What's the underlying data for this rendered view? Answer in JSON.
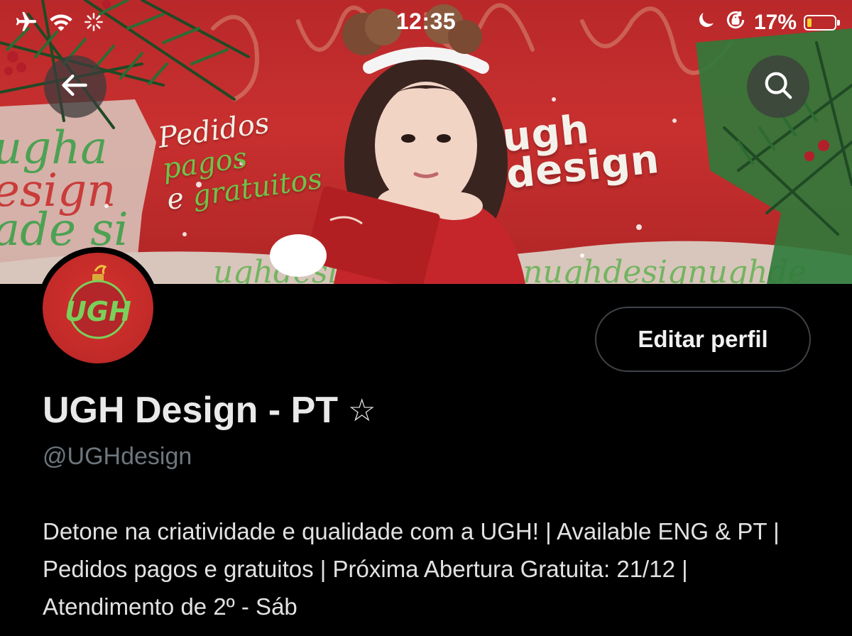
{
  "status_bar": {
    "time": "12:35",
    "battery_percent": "17%",
    "battery_level": 0.17,
    "left_icons": [
      "airplane-icon",
      "wifi-icon",
      "loading-spinner-icon"
    ],
    "right_icons": [
      "moon-icon",
      "orientation-lock-icon",
      "battery-icon"
    ]
  },
  "banner": {
    "tagline_line1": "Pedidos",
    "tagline_line1_green": "pagos",
    "tagline_line2": "e",
    "tagline_line2_green": "gratuitos",
    "brand_line1": "ugh",
    "brand_line2": "design",
    "colors": {
      "red": "#c8302f",
      "green": "#6fc24a",
      "pine": "#1f4a25"
    }
  },
  "nav": {
    "back_icon": "arrow-left-icon",
    "search_icon": "search-icon"
  },
  "avatar": {
    "monogram": "UGH",
    "bg_color": "#c8302f",
    "text_color": "#7ad05a"
  },
  "actions": {
    "edit_profile_label": "Editar perfil"
  },
  "profile": {
    "display_name": "UGH Design - PT",
    "name_symbol": "☆",
    "handle": "@UGHdesign",
    "bio": "Detone na criatividade e qualidade com a UGH! | Available ENG & PT | Pedidos pagos e gratuitos | Próxima Abertura Gratuita: 21/12 | Atendimento de 2º - Sáb"
  }
}
